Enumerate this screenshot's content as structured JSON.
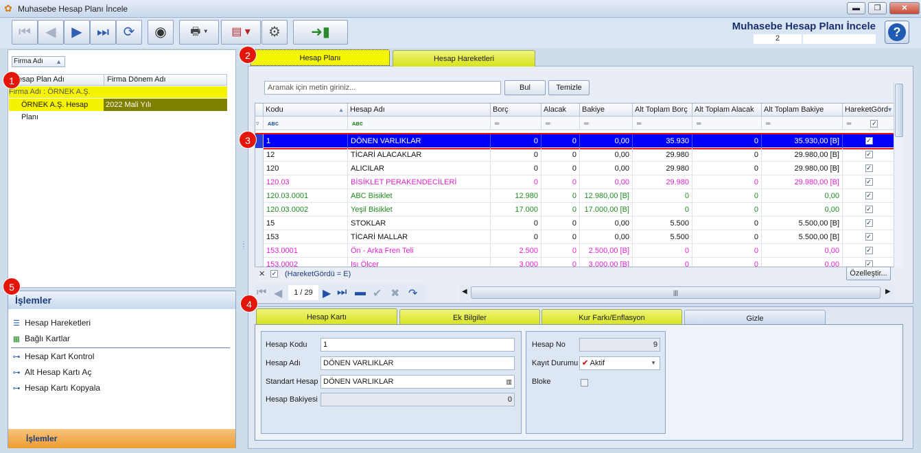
{
  "window": {
    "title": "Muhasebe Hesap Planı İncele",
    "controls": {
      "minimize": "▬",
      "restore": "❐",
      "close": "✕"
    }
  },
  "header": {
    "title": "Muhasebe Hesap Planı İncele",
    "record_no": "2",
    "help": "?"
  },
  "markers": [
    "1",
    "2",
    "3",
    "4",
    "5"
  ],
  "left": {
    "group_by": "Firma Adı",
    "columns": [
      "Hesap Plan Adı",
      "Firma Dönem Adı"
    ],
    "group_row": "Firma Adı : ÖRNEK A.Ş.",
    "rows": [
      {
        "plan": "ÖRNEK A.Ş. Hesap Planı",
        "donem": "2022 Mali Yılı"
      }
    ]
  },
  "islemler": {
    "title": "İşlemler",
    "items": [
      "Hesap Hareketleri",
      "Bağlı Kartlar",
      "Hesap Kart Kontrol",
      "Alt Hesap Kartı Aç",
      "Hesap Kartı Kopyala"
    ],
    "footer": "İşlemler"
  },
  "tabs_top": [
    "Hesap Planı",
    "Hesap Hareketleri"
  ],
  "search": {
    "placeholder": "Aramak için metin giriniz...",
    "find": "Bul",
    "clear": "Temizle"
  },
  "grid": {
    "columns": [
      "Kodu",
      "Hesap Adı",
      "Borç",
      "Alacak",
      "Bakiye",
      "Alt Toplam Borç",
      "Alt Toplam Alacak",
      "Alt Toplam Bakiye",
      "HareketGörd"
    ],
    "rows": [
      {
        "kodu": "1",
        "ad": "DÖNEN VARLIKLAR",
        "borc": "0",
        "alacak": "0",
        "bakiye": "0,00",
        "atb": "35.930",
        "ata": "0",
        "atbak": "35.930,00 [B]",
        "chk": true,
        "color": "#ffffff"
      },
      {
        "kodu": "12",
        "ad": "TİCARİ ALACAKLAR",
        "borc": "0",
        "alacak": "0",
        "bakiye": "0,00",
        "atb": "29.980",
        "ata": "0",
        "atbak": "29.980,00 [B]",
        "chk": true,
        "color": "#111111"
      },
      {
        "kodu": "120",
        "ad": "ALICILAR",
        "borc": "0",
        "alacak": "0",
        "bakiye": "0,00",
        "atb": "29.980",
        "ata": "0",
        "atbak": "29.980,00 [B]",
        "chk": true,
        "color": "#111111"
      },
      {
        "kodu": "120.03",
        "ad": "BİSİKLET PERAKENDECİLERİ",
        "borc": "0",
        "alacak": "0",
        "bakiye": "0,00",
        "atb": "29.980",
        "ata": "0",
        "atbak": "29.980,00 [B]",
        "chk": true,
        "color": "#e020d0"
      },
      {
        "kodu": "120.03.0001",
        "ad": "ABC Bisiklet",
        "borc": "12.980",
        "alacak": "0",
        "bakiye": "12.980,00 [B]",
        "atb": "0",
        "ata": "0",
        "atbak": "0,00",
        "chk": true,
        "color": "#1f8a1f"
      },
      {
        "kodu": "120.03.0002",
        "ad": "Yeşil Bisiklet",
        "borc": "17.000",
        "alacak": "0",
        "bakiye": "17.000,00 [B]",
        "atb": "0",
        "ata": "0",
        "atbak": "0,00",
        "chk": true,
        "color": "#1f8a1f"
      },
      {
        "kodu": "15",
        "ad": "STOKLAR",
        "borc": "0",
        "alacak": "0",
        "bakiye": "0,00",
        "atb": "5.500",
        "ata": "0",
        "atbak": "5.500,00 [B]",
        "chk": true,
        "color": "#111111"
      },
      {
        "kodu": "153",
        "ad": "TİCARİ MALLAR",
        "borc": "0",
        "alacak": "0",
        "bakiye": "0,00",
        "atb": "5.500",
        "ata": "0",
        "atbak": "5.500,00 [B]",
        "chk": true,
        "color": "#111111"
      },
      {
        "kodu": "153.0001",
        "ad": "Ön - Arka Fren Teli",
        "borc": "2.500",
        "alacak": "0",
        "bakiye": "2.500,00 [B]",
        "atb": "0",
        "ata": "0",
        "atbak": "0,00",
        "chk": true,
        "color": "#e020d0"
      },
      {
        "kodu": "153.0002",
        "ad": "Işı Ölçer",
        "borc": "3.000",
        "alacak": "0",
        "bakiye": "3.000,00 [B]",
        "atb": "0",
        "ata": "0",
        "atbak": "0,00",
        "chk": true,
        "color": "#e020d0"
      }
    ],
    "filter_text": "(HareketGördü = E)",
    "customize": "Özelleştir...",
    "page": "1 / 29"
  },
  "tabs_bottom": [
    "Hesap Kartı",
    "Ek Bilgiler",
    "Kur Farkı/Enflasyon",
    "Gizle"
  ],
  "form": {
    "hesap_kodu_lbl": "Hesap Kodu",
    "hesap_kodu": "1",
    "hesap_adi_lbl": "Hesap Adı",
    "hesap_adi": "DÖNEN VARLIKLAR",
    "std_hesap_lbl": "Standart Hesap",
    "std_hesap": "DÖNEN VARLIKLAR",
    "bakiye_lbl": "Hesap Bakiyesi",
    "bakiye": "0",
    "hesap_no_lbl": "Hesap No",
    "hesap_no": "9",
    "kayit_lbl": "Kayıt Durumu",
    "kayit": "Aktif",
    "bloke_lbl": "Bloke"
  }
}
